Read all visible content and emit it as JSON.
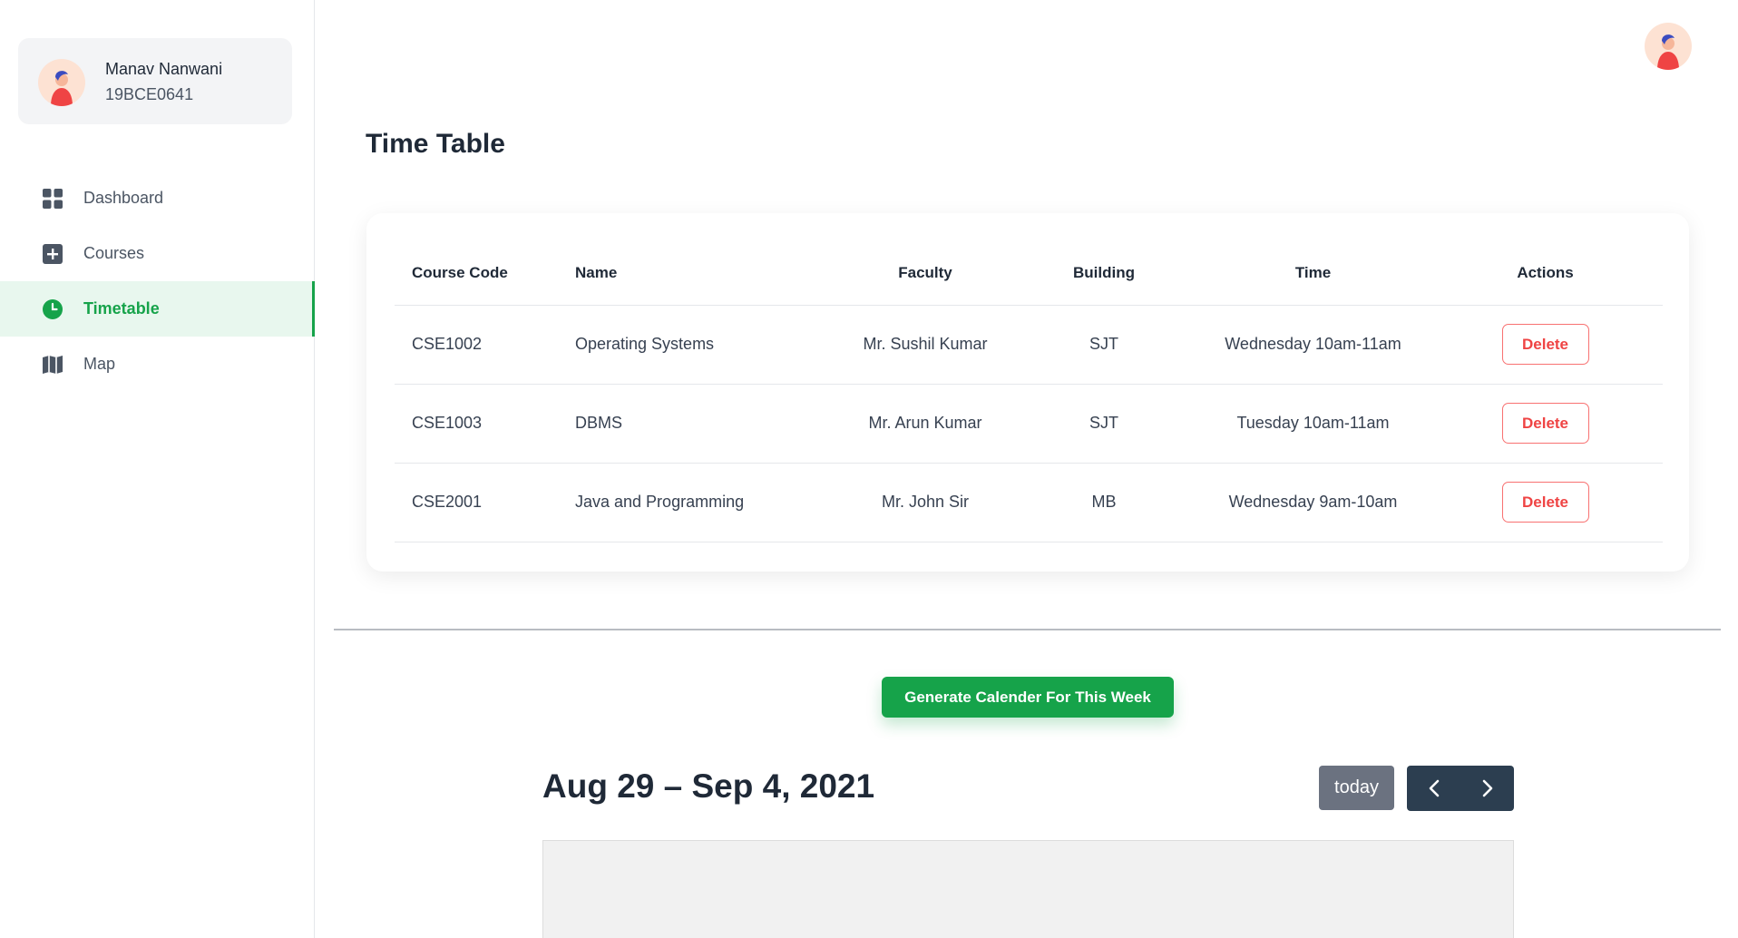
{
  "user": {
    "name": "Manav Nanwani",
    "id": "19BCE0641"
  },
  "sidebar": {
    "items": [
      {
        "label": "Dashboard",
        "icon": "grid-icon",
        "active": false
      },
      {
        "label": "Courses",
        "icon": "plus-square-icon",
        "active": false
      },
      {
        "label": "Timetable",
        "icon": "clock-icon",
        "active": true
      },
      {
        "label": "Map",
        "icon": "map-icon",
        "active": false
      }
    ]
  },
  "page": {
    "title": "Time Table"
  },
  "table": {
    "headers": [
      "Course Code",
      "Name",
      "Faculty",
      "Building",
      "Time",
      "Actions"
    ],
    "rows": [
      {
        "code": "CSE1002",
        "name": "Operating Systems",
        "faculty": "Mr. Sushil Kumar",
        "building": "SJT",
        "time": "Wednesday 10am-11am",
        "action": "Delete"
      },
      {
        "code": "CSE1003",
        "name": "DBMS",
        "faculty": "Mr. Arun Kumar",
        "building": "SJT",
        "time": "Tuesday 10am-11am",
        "action": "Delete"
      },
      {
        "code": "CSE2001",
        "name": "Java and Programming",
        "faculty": "Mr. John Sir",
        "building": "MB",
        "time": "Wednesday 9am-10am",
        "action": "Delete"
      }
    ]
  },
  "generate_button": "Generate Calender For This Week",
  "calendar": {
    "title": "Aug 29 – Sep 4, 2021",
    "today_label": "today"
  },
  "colors": {
    "accent": "#16a34a",
    "danger": "#ef4444",
    "calendar_nav": "#2c3e50"
  }
}
